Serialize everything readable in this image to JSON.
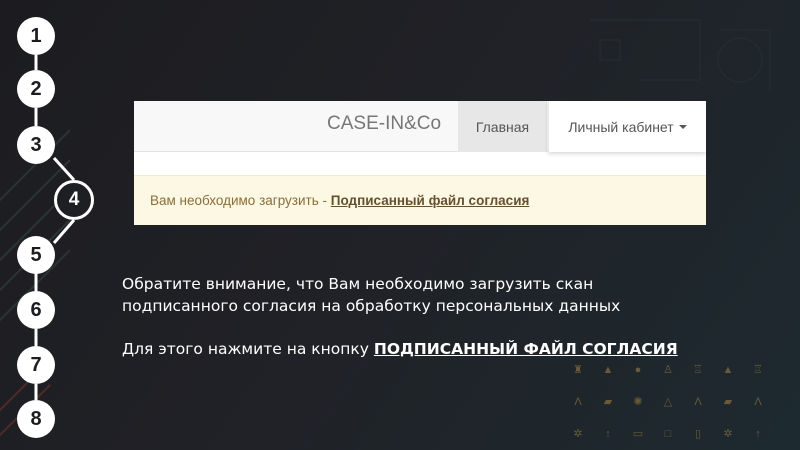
{
  "steps": [
    "1",
    "2",
    "3",
    "4",
    "5",
    "6",
    "7",
    "8"
  ],
  "active_step": "4",
  "screenshot": {
    "brand": "CASE-IN&Co",
    "nav_home": "Главная",
    "nav_cabinet": "Личный кабинет",
    "alert_text": "Вам необходимо загрузить - ",
    "alert_link": "Подписанный файл согласия"
  },
  "instructions": {
    "line1": "Обратите внимание, что Вам необходимо загрузить скан",
    "line2": "подписанного согласия на обработку персональных данных",
    "line3_prefix": "Для этого нажмите на кнопку ",
    "line3_button": "ПОДПИСАННЫЙ ФАЙЛ СОГЛАСИЯ"
  },
  "colors": {
    "background": "#1f2024",
    "alert_bg": "#fcf8e3",
    "alert_text": "#8a6d3b",
    "step_fill": "#ffffff"
  }
}
